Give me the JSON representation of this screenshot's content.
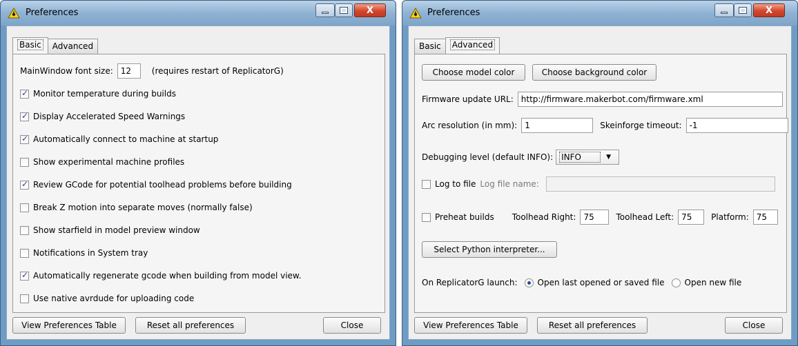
{
  "windows": [
    {
      "title": "Preferences",
      "close_glyph": "X",
      "tabs": [
        {
          "label": "Basic"
        },
        {
          "label": "Advanced"
        }
      ],
      "active_tab": "Basic",
      "basic": {
        "font_size_label": "MainWindow font size:",
        "font_size_value": "12",
        "font_size_note": "(requires restart of ReplicatorG)",
        "options": [
          {
            "label": "Monitor temperature during builds",
            "checked": true
          },
          {
            "label": "Display Accelerated Speed Warnings",
            "checked": true
          },
          {
            "label": "Automatically connect to machine at startup",
            "checked": true
          },
          {
            "label": "Show experimental machine profiles",
            "checked": false
          },
          {
            "label": "Review GCode for potential toolhead problems before building",
            "checked": true
          },
          {
            "label": "Break Z motion into separate moves (normally false)",
            "checked": false
          },
          {
            "label": "Show starfield in model preview window",
            "checked": false
          },
          {
            "label": "Notifications in System tray",
            "checked": false
          },
          {
            "label": "Automatically regenerate gcode when building from model view.",
            "checked": true
          },
          {
            "label": "Use native avrdude for uploading code",
            "checked": false
          }
        ]
      },
      "footer": {
        "view_table": "View Preferences Table",
        "reset": "Reset all preferences",
        "close": "Close"
      }
    },
    {
      "title": "Preferences",
      "close_glyph": "X",
      "tabs": [
        {
          "label": "Basic"
        },
        {
          "label": "Advanced"
        }
      ],
      "active_tab": "Advanced",
      "advanced": {
        "choose_model_color": "Choose model color",
        "choose_background_color": "Choose background color",
        "firmware_url_label": "Firmware update URL:",
        "firmware_url_value": "http://firmware.makerbot.com/firmware.xml",
        "arc_resolution_label": "Arc resolution (in mm):",
        "arc_resolution_value": "1",
        "skeinforge_timeout_label": "Skeinforge timeout:",
        "skeinforge_timeout_value": "-1",
        "debug_level_label": "Debugging level (default INFO):",
        "debug_level_value": "INFO",
        "log_to_file_label": "Log to file",
        "log_to_file_checked": false,
        "log_file_name_label": "Log file name:",
        "log_file_name_value": "",
        "preheat_label": "Preheat builds",
        "preheat_checked": false,
        "toolhead_right_label": "Toolhead Right:",
        "toolhead_right_value": "75",
        "toolhead_left_label": "Toolhead Left:",
        "toolhead_left_value": "75",
        "platform_label": "Platform:",
        "platform_value": "75",
        "python_button": "Select Python interpreter...",
        "launch_label": "On ReplicatorG launch:",
        "launch_options": [
          {
            "label": "Open last opened or saved file",
            "selected": true
          },
          {
            "label": "Open new file",
            "selected": false
          }
        ]
      },
      "footer": {
        "view_table": "View Preferences Table",
        "reset": "Reset all preferences",
        "close": "Close"
      }
    }
  ],
  "colors": {
    "title_bar": "#8fb2d3",
    "content_bg": "#efefef",
    "close_button": "#d2472d",
    "check_mark": "#2a4a8a"
  }
}
